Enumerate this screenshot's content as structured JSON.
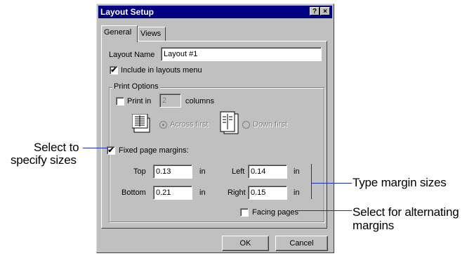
{
  "dialog": {
    "title": "Layout Setup",
    "help_label": "?",
    "close_label": "×",
    "tabs": [
      {
        "label": "General"
      },
      {
        "label": "Views"
      }
    ],
    "layout_name": {
      "label": "Layout Name",
      "value": "Layout #1"
    },
    "include_in_menu": {
      "label": "Include in layouts menu",
      "checked": true
    },
    "print_options": {
      "title": "Print Options",
      "print_in": {
        "label": "Print in",
        "value": "2",
        "suffix": "columns",
        "checked": false
      },
      "across_first": {
        "label": "Across first",
        "selected": true
      },
      "down_first": {
        "label": "Down first",
        "selected": false
      },
      "fixed_margins": {
        "label": "Fixed page margins:",
        "checked": true
      },
      "margins": {
        "top": {
          "label": "Top",
          "value": "0.13",
          "unit": "in"
        },
        "left": {
          "label": "Left",
          "value": "0.14",
          "unit": "in"
        },
        "bottom": {
          "label": "Bottom",
          "value": "0.21",
          "unit": "in"
        },
        "right": {
          "label": "Right",
          "value": "0.15",
          "unit": "in"
        }
      },
      "facing_pages": {
        "label": "Facing pages",
        "checked": false
      }
    },
    "ok_label": "OK",
    "cancel_label": "Cancel"
  },
  "callouts": {
    "select_sizes": [
      "Select to",
      "specify sizes"
    ],
    "type_margins": "Type margin sizes",
    "alternating": [
      "Select for alternating",
      "margins"
    ]
  },
  "colors": {
    "titlebar": "#000080",
    "face": "#c0c0c0",
    "callout_line": "#1f2fbf"
  }
}
